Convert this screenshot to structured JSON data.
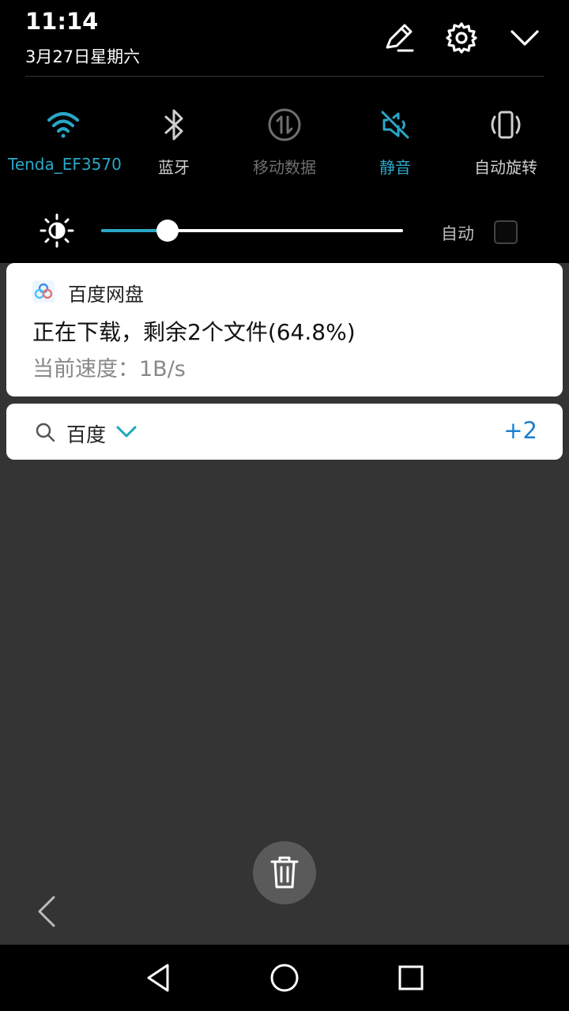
{
  "status": {
    "time": "11:14",
    "date": "3月27日星期六"
  },
  "header": {
    "edit_icon": "pencil-icon",
    "settings_icon": "gear-icon",
    "collapse_icon": "chevron-down-icon"
  },
  "quick_settings": [
    {
      "label": "Tenda_EF3570",
      "icon": "wifi-icon",
      "state": "on"
    },
    {
      "label": "蓝牙",
      "icon": "bluetooth-icon",
      "state": "off"
    },
    {
      "label": "移动数据",
      "icon": "mobile-data-icon",
      "state": "disabled"
    },
    {
      "label": "静音",
      "icon": "mute-icon",
      "state": "on"
    },
    {
      "label": "自动旋转",
      "icon": "rotate-icon",
      "state": "off"
    }
  ],
  "brightness": {
    "level_percent": 22,
    "auto_label": "自动",
    "auto_checked": false
  },
  "notifications": [
    {
      "app": "百度网盘",
      "title": "正在下载，剩余2个文件(64.8%)",
      "text": "当前速度：1B/s"
    }
  ],
  "search_notification": {
    "label": "百度",
    "count": "+2"
  },
  "colors": {
    "accent": "#2aa7c7",
    "count_blue": "#1b7fd1",
    "shade": "#000000",
    "background": "#343434"
  }
}
